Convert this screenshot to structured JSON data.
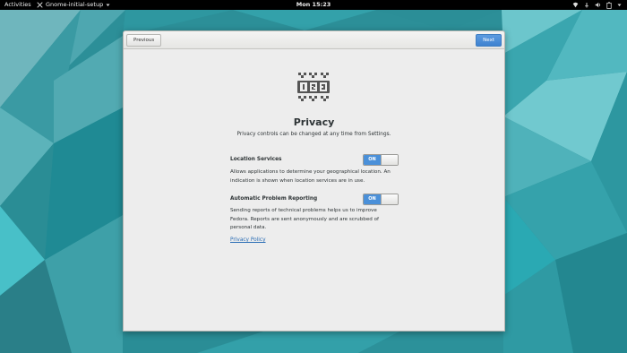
{
  "topbar": {
    "activities": "Activities",
    "app_name": "Gnome-initial-setup",
    "clock": "Mon 15:23",
    "status_icons": [
      "network-icon",
      "notification-icon",
      "volume-icon",
      "battery-icon",
      "system-menu-chevron-icon"
    ]
  },
  "header": {
    "previous_label": "Previous",
    "next_label": "Next"
  },
  "page": {
    "title": "Privacy",
    "subtitle": "Privacy controls can be changed at any time from Settings."
  },
  "location": {
    "label": "Location Services",
    "switch_state": "ON",
    "description": "Allows applications to determine your geographical location. An indication is shown when location services are in use."
  },
  "reporting": {
    "label": "Automatic Problem Reporting",
    "switch_state": "ON",
    "description": "Sending reports of technical problems helps us to improve Fedora. Reports are sent anonymously and are scrubbed of personal data."
  },
  "privacy_policy_link": "Privacy Policy",
  "colors": {
    "accent": "#4a90d9",
    "link": "#2a6db5",
    "topbar": "#000000",
    "window_bg": "#ededed"
  }
}
